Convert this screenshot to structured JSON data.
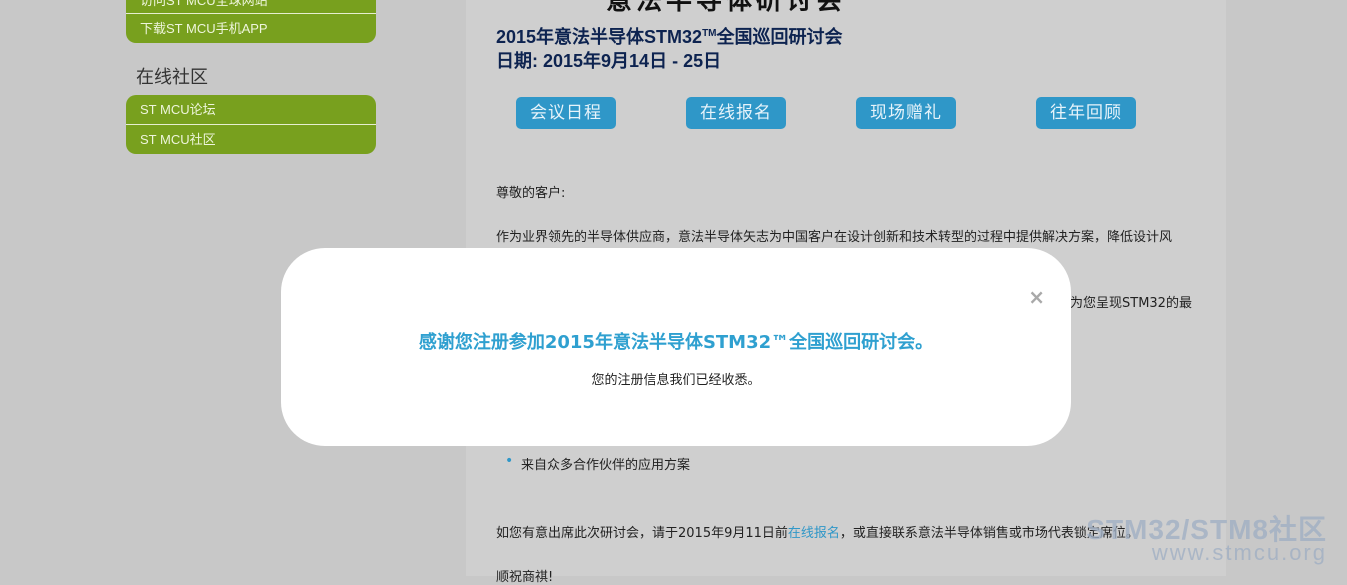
{
  "sidebar": {
    "top_items": [
      "访问ST MCU全球网站",
      "下载ST MCU手机APP"
    ],
    "section_title": "在线社区",
    "community_items": [
      "ST MCU论坛",
      "ST MCU社区"
    ]
  },
  "main": {
    "cut_title": "意法半导体研讨会",
    "title_prefix": "2015年意法半导体STM32",
    "title_tm": "TM",
    "title_suffix": "全国巡回研讨会",
    "date_line": "日期: 2015年9月14日 - 25日",
    "buttons": [
      "会议日程",
      "在线报名",
      "现场赠礼",
      "往年回顾"
    ],
    "greeting": "尊敬的客户:",
    "para1": "作为业界领先的半导体供应商，意法半导体矢志为中国客户在设计创新和技术转型的过程中提供解决方案，降低设计风",
    "para2_tail": "为您呈现STM32的最",
    "bullet1": "来自众多合作伙伴的应用方案",
    "register_prefix": "如您有意出席此次研讨会，请于2015年9月11日前",
    "register_link": "在线报名",
    "register_suffix": "，或直接联系意法半导体销售或市场代表锁定席位。",
    "closing": "顺祝商祺!"
  },
  "watermark": {
    "line1": "STM32/STM8社区",
    "line2": "www.stmcu.org"
  },
  "modal": {
    "close_symbol": "×",
    "title": "感谢您注册参加2015年意法半导体STM32™全国巡回研讨会。",
    "subtitle": "您的注册信息我们已经收悉。"
  },
  "colors": {
    "green": "#78a01e",
    "blue_button": "#2f97c8",
    "modal_title": "#2fa0d0",
    "heading": "#0d2350"
  }
}
